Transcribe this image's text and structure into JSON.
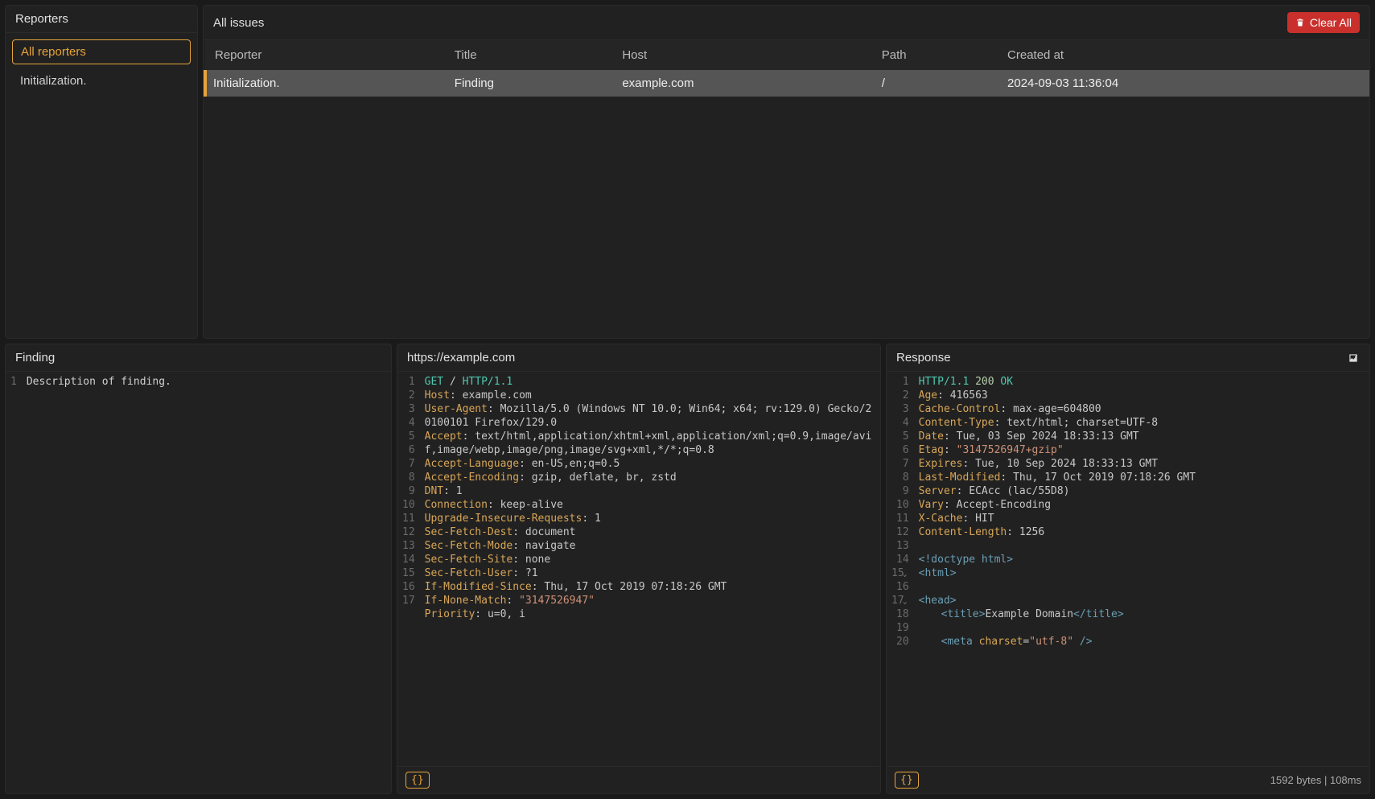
{
  "reporters_panel": {
    "title": "Reporters",
    "items": [
      {
        "label": "All reporters",
        "active": true
      },
      {
        "label": "Initialization.",
        "active": false
      }
    ]
  },
  "issues_panel": {
    "title": "All issues",
    "clear_button": "Clear All",
    "columns": [
      "Reporter",
      "Title",
      "Host",
      "Path",
      "Created at"
    ],
    "rows": [
      {
        "reporter": "Initialization.",
        "title": "Finding",
        "host": "example.com",
        "path": "/",
        "created_at": "2024-09-03 11:36:04",
        "selected": true
      }
    ]
  },
  "finding_panel": {
    "title": "Finding",
    "lines": [
      {
        "n": "1",
        "text": "Description of finding."
      }
    ]
  },
  "request_panel": {
    "title": "https://example.com",
    "format_btn": "{}",
    "lines": [
      {
        "n": "1",
        "segments": [
          {
            "t": "method",
            "v": "GET"
          },
          {
            "t": "punct",
            "v": " / "
          },
          {
            "t": "proto",
            "v": "HTTP/1.1"
          }
        ]
      },
      {
        "n": "2",
        "segments": [
          {
            "t": "header",
            "v": "Host"
          },
          {
            "t": "punct",
            "v": ": "
          },
          {
            "t": "val",
            "v": "example.com"
          }
        ]
      },
      {
        "n": "3",
        "segments": [
          {
            "t": "header",
            "v": "User-Agent"
          },
          {
            "t": "punct",
            "v": ": "
          },
          {
            "t": "val",
            "v": "Mozilla/5.0 (Windows NT 10.0; Win64; x64; rv:129.0) Gecko/20100101 Firefox/129.0"
          }
        ]
      },
      {
        "n": "4",
        "segments": [
          {
            "t": "header",
            "v": "Accept"
          },
          {
            "t": "punct",
            "v": ": "
          },
          {
            "t": "val",
            "v": "text/html,application/xhtml+xml,application/xml;q=0.9,image/avif,image/webp,image/png,image/svg+xml,*/*;q=0.8"
          }
        ]
      },
      {
        "n": "5",
        "segments": [
          {
            "t": "header",
            "v": "Accept-Language"
          },
          {
            "t": "punct",
            "v": ": "
          },
          {
            "t": "val",
            "v": "en-US,en;q=0.5"
          }
        ]
      },
      {
        "n": "6",
        "segments": [
          {
            "t": "header",
            "v": "Accept-Encoding"
          },
          {
            "t": "punct",
            "v": ": "
          },
          {
            "t": "val",
            "v": "gzip, deflate, br, zstd"
          }
        ]
      },
      {
        "n": "7",
        "segments": [
          {
            "t": "header",
            "v": "DNT"
          },
          {
            "t": "punct",
            "v": ": "
          },
          {
            "t": "val",
            "v": "1"
          }
        ]
      },
      {
        "n": "8",
        "segments": [
          {
            "t": "header",
            "v": "Connection"
          },
          {
            "t": "punct",
            "v": ": "
          },
          {
            "t": "val",
            "v": "keep-alive"
          }
        ]
      },
      {
        "n": "9",
        "segments": [
          {
            "t": "header",
            "v": "Upgrade-Insecure-Requests"
          },
          {
            "t": "punct",
            "v": ": "
          },
          {
            "t": "val",
            "v": "1"
          }
        ]
      },
      {
        "n": "10",
        "segments": [
          {
            "t": "header",
            "v": "Sec-Fetch-Dest"
          },
          {
            "t": "punct",
            "v": ": "
          },
          {
            "t": "val",
            "v": "document"
          }
        ]
      },
      {
        "n": "11",
        "segments": [
          {
            "t": "header",
            "v": "Sec-Fetch-Mode"
          },
          {
            "t": "punct",
            "v": ": "
          },
          {
            "t": "val",
            "v": "navigate"
          }
        ]
      },
      {
        "n": "12",
        "segments": [
          {
            "t": "header",
            "v": "Sec-Fetch-Site"
          },
          {
            "t": "punct",
            "v": ": "
          },
          {
            "t": "val",
            "v": "none"
          }
        ]
      },
      {
        "n": "13",
        "segments": [
          {
            "t": "header",
            "v": "Sec-Fetch-User"
          },
          {
            "t": "punct",
            "v": ": "
          },
          {
            "t": "val",
            "v": "?1"
          }
        ]
      },
      {
        "n": "14",
        "segments": [
          {
            "t": "header",
            "v": "If-Modified-Since"
          },
          {
            "t": "punct",
            "v": ": "
          },
          {
            "t": "val",
            "v": "Thu, 17 Oct 2019 07:18:26 GMT"
          }
        ]
      },
      {
        "n": "15",
        "segments": [
          {
            "t": "header",
            "v": "If-None-Match"
          },
          {
            "t": "punct",
            "v": ": "
          },
          {
            "t": "str",
            "v": "\"3147526947\""
          }
        ]
      },
      {
        "n": "16",
        "segments": [
          {
            "t": "header",
            "v": "Priority"
          },
          {
            "t": "punct",
            "v": ": "
          },
          {
            "t": "val",
            "v": "u=0, i"
          }
        ]
      },
      {
        "n": "17",
        "segments": []
      }
    ]
  },
  "response_panel": {
    "title": "Response",
    "format_btn": "{}",
    "status_text": "1592 bytes  |  108ms",
    "lines": [
      {
        "n": "1",
        "segments": [
          {
            "t": "proto",
            "v": "HTTP/1.1"
          },
          {
            "t": "punct",
            "v": " "
          },
          {
            "t": "num",
            "v": "200"
          },
          {
            "t": "punct",
            "v": " "
          },
          {
            "t": "status",
            "v": "OK"
          }
        ]
      },
      {
        "n": "2",
        "segments": [
          {
            "t": "header",
            "v": "Age"
          },
          {
            "t": "punct",
            "v": ": "
          },
          {
            "t": "val",
            "v": "416563"
          }
        ]
      },
      {
        "n": "3",
        "segments": [
          {
            "t": "header",
            "v": "Cache-Control"
          },
          {
            "t": "punct",
            "v": ": "
          },
          {
            "t": "val",
            "v": "max-age=604800"
          }
        ]
      },
      {
        "n": "4",
        "segments": [
          {
            "t": "header",
            "v": "Content-Type"
          },
          {
            "t": "punct",
            "v": ": "
          },
          {
            "t": "val",
            "v": "text/html; charset=UTF-8"
          }
        ]
      },
      {
        "n": "5",
        "segments": [
          {
            "t": "header",
            "v": "Date"
          },
          {
            "t": "punct",
            "v": ": "
          },
          {
            "t": "val",
            "v": "Tue, 03 Sep 2024 18:33:13 GMT"
          }
        ]
      },
      {
        "n": "6",
        "segments": [
          {
            "t": "header",
            "v": "Etag"
          },
          {
            "t": "punct",
            "v": ": "
          },
          {
            "t": "str",
            "v": "\"3147526947+gzip\""
          }
        ]
      },
      {
        "n": "7",
        "segments": [
          {
            "t": "header",
            "v": "Expires"
          },
          {
            "t": "punct",
            "v": ": "
          },
          {
            "t": "val",
            "v": "Tue, 10 Sep 2024 18:33:13 GMT"
          }
        ]
      },
      {
        "n": "8",
        "segments": [
          {
            "t": "header",
            "v": "Last-Modified"
          },
          {
            "t": "punct",
            "v": ": "
          },
          {
            "t": "val",
            "v": "Thu, 17 Oct 2019 07:18:26 GMT"
          }
        ]
      },
      {
        "n": "9",
        "segments": [
          {
            "t": "header",
            "v": "Server"
          },
          {
            "t": "punct",
            "v": ": "
          },
          {
            "t": "val",
            "v": "ECAcc (lac/55D8)"
          }
        ]
      },
      {
        "n": "10",
        "segments": [
          {
            "t": "header",
            "v": "Vary"
          },
          {
            "t": "punct",
            "v": ": "
          },
          {
            "t": "val",
            "v": "Accept-Encoding"
          }
        ]
      },
      {
        "n": "11",
        "segments": [
          {
            "t": "header",
            "v": "X-Cache"
          },
          {
            "t": "punct",
            "v": ": "
          },
          {
            "t": "val",
            "v": "HIT"
          }
        ]
      },
      {
        "n": "12",
        "segments": [
          {
            "t": "header",
            "v": "Content-Length"
          },
          {
            "t": "punct",
            "v": ": "
          },
          {
            "t": "val",
            "v": "1256"
          }
        ]
      },
      {
        "n": "13",
        "segments": []
      },
      {
        "n": "14",
        "segments": [
          {
            "t": "tag",
            "v": "<!doctype html>"
          }
        ]
      },
      {
        "n": "15",
        "fold": true,
        "segments": [
          {
            "t": "tag",
            "v": "<html>"
          }
        ]
      },
      {
        "n": "16",
        "segments": []
      },
      {
        "n": "17",
        "fold": true,
        "segments": [
          {
            "t": "tag",
            "v": "<head>"
          }
        ]
      },
      {
        "n": "18",
        "indent": 1,
        "segments": [
          {
            "t": "tag",
            "v": "<title>"
          },
          {
            "t": "text",
            "v": "Example Domain"
          },
          {
            "t": "tag",
            "v": "</title>"
          }
        ]
      },
      {
        "n": "19",
        "segments": []
      },
      {
        "n": "20",
        "indent": 1,
        "segments": [
          {
            "t": "tag",
            "v": "<meta "
          },
          {
            "t": "attr",
            "v": "charset"
          },
          {
            "t": "punct",
            "v": "="
          },
          {
            "t": "str",
            "v": "\"utf-8\""
          },
          {
            "t": "tag",
            "v": " />"
          }
        ]
      }
    ]
  }
}
